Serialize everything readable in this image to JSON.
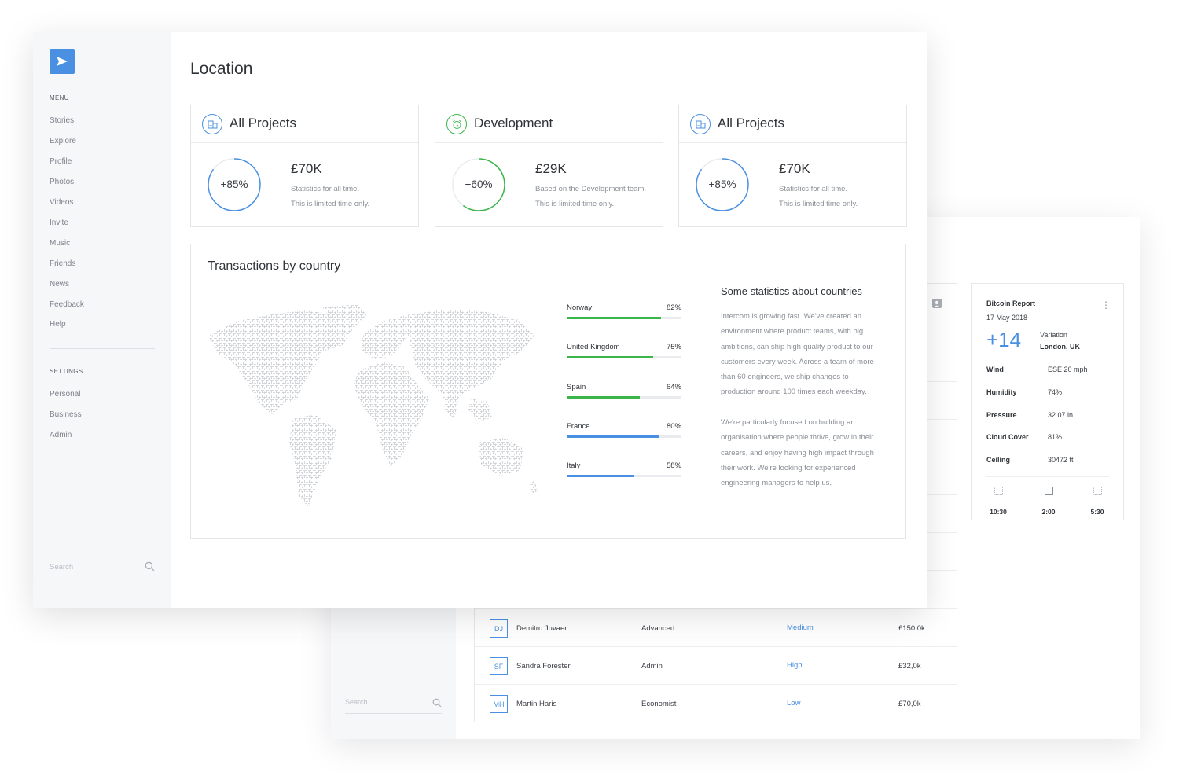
{
  "sidebar": {
    "menu_label": "MENU",
    "menu_items": [
      "Stories",
      "Explore",
      "Profile",
      "Photos",
      "Videos",
      "Invite",
      "Music",
      "Friends",
      "News",
      "Feedback",
      "Help"
    ],
    "settings_label": "SETTINGS",
    "settings_items": [
      "Personal",
      "Business",
      "Admin"
    ],
    "search_placeholder": "Search"
  },
  "page": {
    "title": "Location"
  },
  "cards": [
    {
      "title": "All Projects",
      "percent_label": "+85%",
      "percent": 85,
      "amount": "£70K",
      "desc1": "Statistics for all time.",
      "desc2": "This is limited time only.",
      "icon": "building-icon",
      "color": "#4a90e2"
    },
    {
      "title": "Development",
      "percent_label": "+60%",
      "percent": 60,
      "amount": "£29K",
      "desc1": "Based on the Development team.",
      "desc2": "This is limited time only.",
      "icon": "alarm-clock-icon",
      "color": "#3cb54a"
    },
    {
      "title": "All Projects",
      "percent_label": "+85%",
      "percent": 85,
      "amount": "£70K",
      "desc1": "Statistics for all time.",
      "desc2": "This is limited time only.",
      "icon": "building-icon",
      "color": "#4a90e2"
    }
  ],
  "transactions": {
    "title": "Transactions by country",
    "countries": [
      {
        "name": "Norway",
        "percent_label": "82%",
        "percent": 82,
        "color": "#3cb54a"
      },
      {
        "name": "United Kingdom",
        "percent_label": "75%",
        "percent": 75,
        "color": "#3cb54a"
      },
      {
        "name": "Spain",
        "percent_label": "64%",
        "percent": 64,
        "color": "#3cb54a"
      },
      {
        "name": "France",
        "percent_label": "80%",
        "percent": 80,
        "color": "#4a90e2"
      },
      {
        "name": "Italy",
        "percent_label": "58%",
        "percent": 58,
        "color": "#4a90e2"
      }
    ],
    "stats_title": "Some statistics about countries",
    "stats_lines_1": [
      "Intercom is growing fast. We've created an",
      "environment where product teams, with big",
      "ambitions, can ship high-quality product to our",
      "customers every week. Across a team of more",
      "than 60 engineers, we ship changes to",
      "production around 100 times each weekday."
    ],
    "stats_lines_2": [
      "We're particularly focused on building an",
      "organisation where people thrive, grow in their",
      "careers, and enjoy having high impact through",
      "their work. We're looking for experienced",
      "engineering managers to help us."
    ]
  },
  "back": {
    "search_placeholder": "Search",
    "rows": [
      {
        "initials": "DJ",
        "name": "Demitro Juvaer",
        "role": "Advanced",
        "priority": "Medium",
        "amount": "£150,0k"
      },
      {
        "initials": "SF",
        "name": "Sandra Forester",
        "role": "Admin",
        "priority": "High",
        "amount": "£32,0k"
      },
      {
        "initials": "MH",
        "name": "Martin Haris",
        "role": "Economist",
        "priority": "Low",
        "amount": "£70,0k"
      }
    ],
    "weather": {
      "title": "Bitcoin Report",
      "date": "17 May 2018",
      "big_value": "+14",
      "variation_label": "Variation",
      "location": "London, UK",
      "rows": [
        {
          "key": "Wind",
          "value": "ESE 20 mph"
        },
        {
          "key": "Humidity",
          "value": "74%"
        },
        {
          "key": "Pressure",
          "value": "32.07 in"
        },
        {
          "key": "Cloud Cover",
          "value": "81%"
        },
        {
          "key": "Ceiling",
          "value": "30472 ft"
        }
      ],
      "times": [
        "10:30",
        "2:00",
        "5:30"
      ]
    }
  },
  "colors": {
    "accent": "#4a90e2",
    "green": "#3cb54a",
    "sidebar_bg": "#f6f7f9"
  }
}
